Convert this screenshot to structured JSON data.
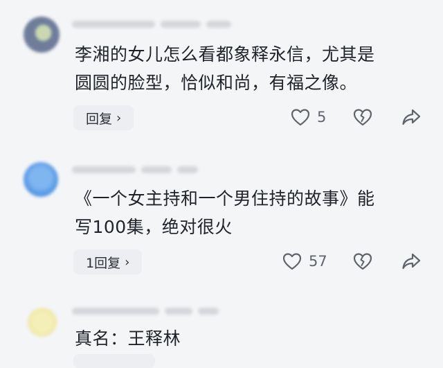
{
  "comments": [
    {
      "avatar_color": "#6f7d9b",
      "text_line1": "李湘的女儿怎么看都象释永信，尤其是",
      "text_line2": "圆圆的脸型，恰似和尚，有福之像。",
      "reply_label": "回复",
      "like_count": "5"
    },
    {
      "avatar_color": "#5b9be6",
      "text_line1": "《一个女主持和一个男住持的故事》能",
      "text_line2": "写100集，绝对很火",
      "reply_label": "1回复",
      "like_count": "57"
    },
    {
      "avatar_color": "#efe7a6",
      "text_line1": "真名：王释林"
    }
  ],
  "icons": {
    "chevron": "›",
    "like": "heart-outline-icon",
    "dislike": "broken-heart-icon",
    "share": "share-arrow-icon"
  },
  "colors": {
    "background": "#f4f5f7",
    "text": "#1f2329",
    "icon": "#5f646b",
    "reply_bg": "#eceef1"
  }
}
